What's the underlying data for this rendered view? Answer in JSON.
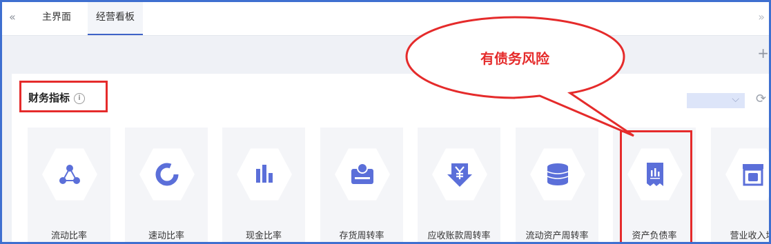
{
  "tabs": {
    "prev_icon": "«",
    "next_icon": "»",
    "items": [
      "主界面",
      "经营看板"
    ]
  },
  "toolbar": {
    "plus": "+"
  },
  "section": {
    "title": "财务指标",
    "info": "i"
  },
  "callout": {
    "text": "有债务风险"
  },
  "cards": [
    {
      "label": "流动比率",
      "icon": "network-icon"
    },
    {
      "label": "速动比率",
      "icon": "ring-chart-icon"
    },
    {
      "label": "现金比率",
      "icon": "bar-chart-icon"
    },
    {
      "label": "存货周转率",
      "icon": "cash-register-icon"
    },
    {
      "label": "应收账款周转率",
      "icon": "yen-down-icon"
    },
    {
      "label": "流动资产周转率",
      "icon": "coin-stack-icon"
    },
    {
      "label": "资产负债率",
      "icon": "receipt-chart-icon"
    },
    {
      "label": "营业收入增",
      "icon": "store-icon"
    }
  ],
  "colors": {
    "accent": "#5b6fd9",
    "highlight": "#e52b2b",
    "frame": "#3e6fd0"
  }
}
